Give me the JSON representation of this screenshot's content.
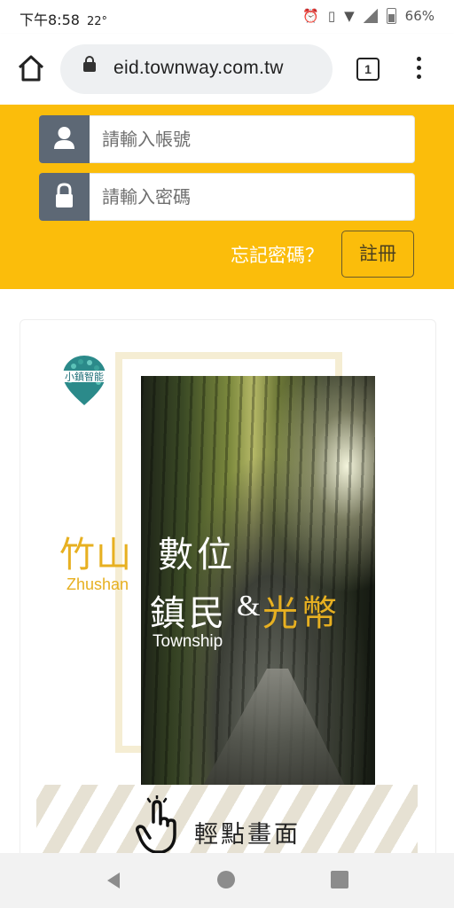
{
  "status_bar": {
    "time": "下午8:58",
    "temp": "22°",
    "battery": "66%"
  },
  "browser": {
    "url": "eid.townway.com.tw",
    "tab_count": "1"
  },
  "login": {
    "username_placeholder": "請輸入帳號",
    "password_placeholder": "請輸入密碼",
    "forgot_label": "忘記密碼？",
    "register_label": "註冊"
  },
  "banner": {
    "logo_text": "小鎮智能",
    "title_cn_1": "竹山",
    "title_cn_2": "數位",
    "title_en_1": "Zhushan",
    "title_cn_3": "鎮民",
    "amp": "&",
    "title_cn_4": "光幣",
    "title_en_2": "Township",
    "tap_label": "輕點畫面"
  },
  "colors": {
    "accent_yellow": "#fbbd0b",
    "gold_text": "#e7b021",
    "addon_gray": "#5d6875"
  }
}
